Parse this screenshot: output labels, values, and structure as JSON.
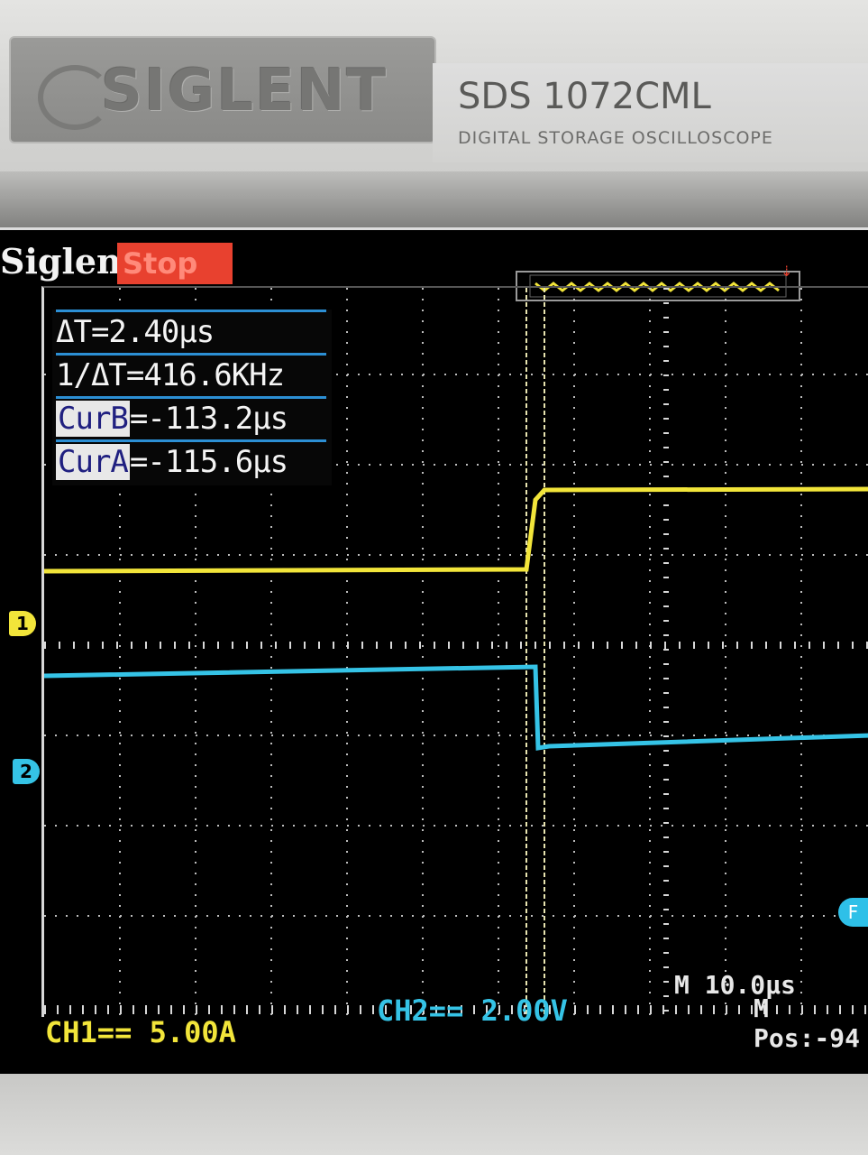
{
  "device": {
    "brand": "SIGLENT",
    "model": "SDS 1072CML",
    "description": "DIGITAL STORAGE OSCILLOSCOPE"
  },
  "screen": {
    "brand": "Siglent",
    "run_state": "Stop",
    "cursor_readout": {
      "delta_t": "ΔT=2.40μs",
      "inverse_delta_t": "1/ΔT=416.6KHz",
      "cur_b_label": "CurB",
      "cur_b_value": "=-113.2μs",
      "cur_a_label": "CurA",
      "cur_a_value": "=-115.6μs"
    },
    "ch1_marker": "1",
    "ch2_marker": "2",
    "ch1_scale": "CH1== 5.00A",
    "ch2_scale": "CH2== 2.00V",
    "timebase": "M 10.0μs",
    "position": "M Pos:-94",
    "f_marker": "F",
    "colors": {
      "ch1": "#f2e53a",
      "ch2": "#35c3e6",
      "grid": "#d9d9d9",
      "cursor_line": "#e8e4b0",
      "readout_border": "#2c8fd4",
      "stop_badge": "#e8412f"
    }
  }
}
